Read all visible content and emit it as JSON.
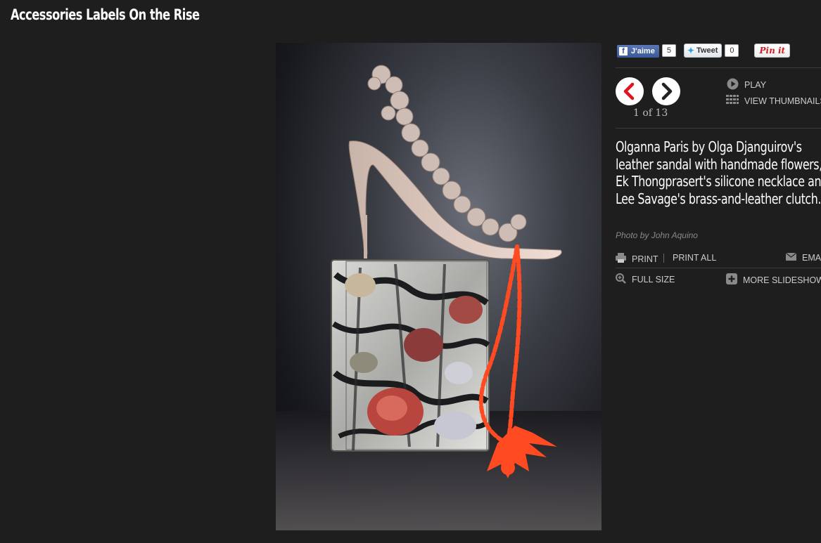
{
  "page": {
    "title": "Accessories Labels On the Rise"
  },
  "social": {
    "facebook_label": "J'aime",
    "facebook_count": "5",
    "tweet_label": "Tweet",
    "tweet_count": "0",
    "pinit_label": "Pin it"
  },
  "slideshow": {
    "counter": "1 of 13",
    "play_label": "PLAY",
    "thumbnails_label": "VIEW THUMBNAILS",
    "caption_lines": [
      "Olganna Paris by Olga Djanguirov's",
      "leather sandal with handmade flowers,",
      "Ek Thongprasert's silicone necklace and",
      "Lee Savage's brass-and-leather clutch."
    ],
    "credit": "Photo by John Aquino"
  },
  "actions": {
    "print_label": "PRINT",
    "print_all_label": "PRINT ALL",
    "email_label": "EMAIL",
    "full_size_label": "FULL SIZE",
    "more_slideshows_label": "MORE SLIDESHOWS"
  },
  "icons": {
    "prev": "chevron-left-icon",
    "next": "chevron-right-icon",
    "play": "play-icon",
    "thumbnails": "grid-icon",
    "print": "printer-icon",
    "email": "envelope-icon",
    "full_size": "zoom-icon",
    "more": "plus-icon"
  },
  "colors": {
    "background": "#1e1e1e",
    "prev_arrow": "#e0141e",
    "next_arrow": "#222222",
    "necklace": "#ff4a22",
    "facebook": "#3b5998",
    "pinterest": "#cb2027"
  }
}
